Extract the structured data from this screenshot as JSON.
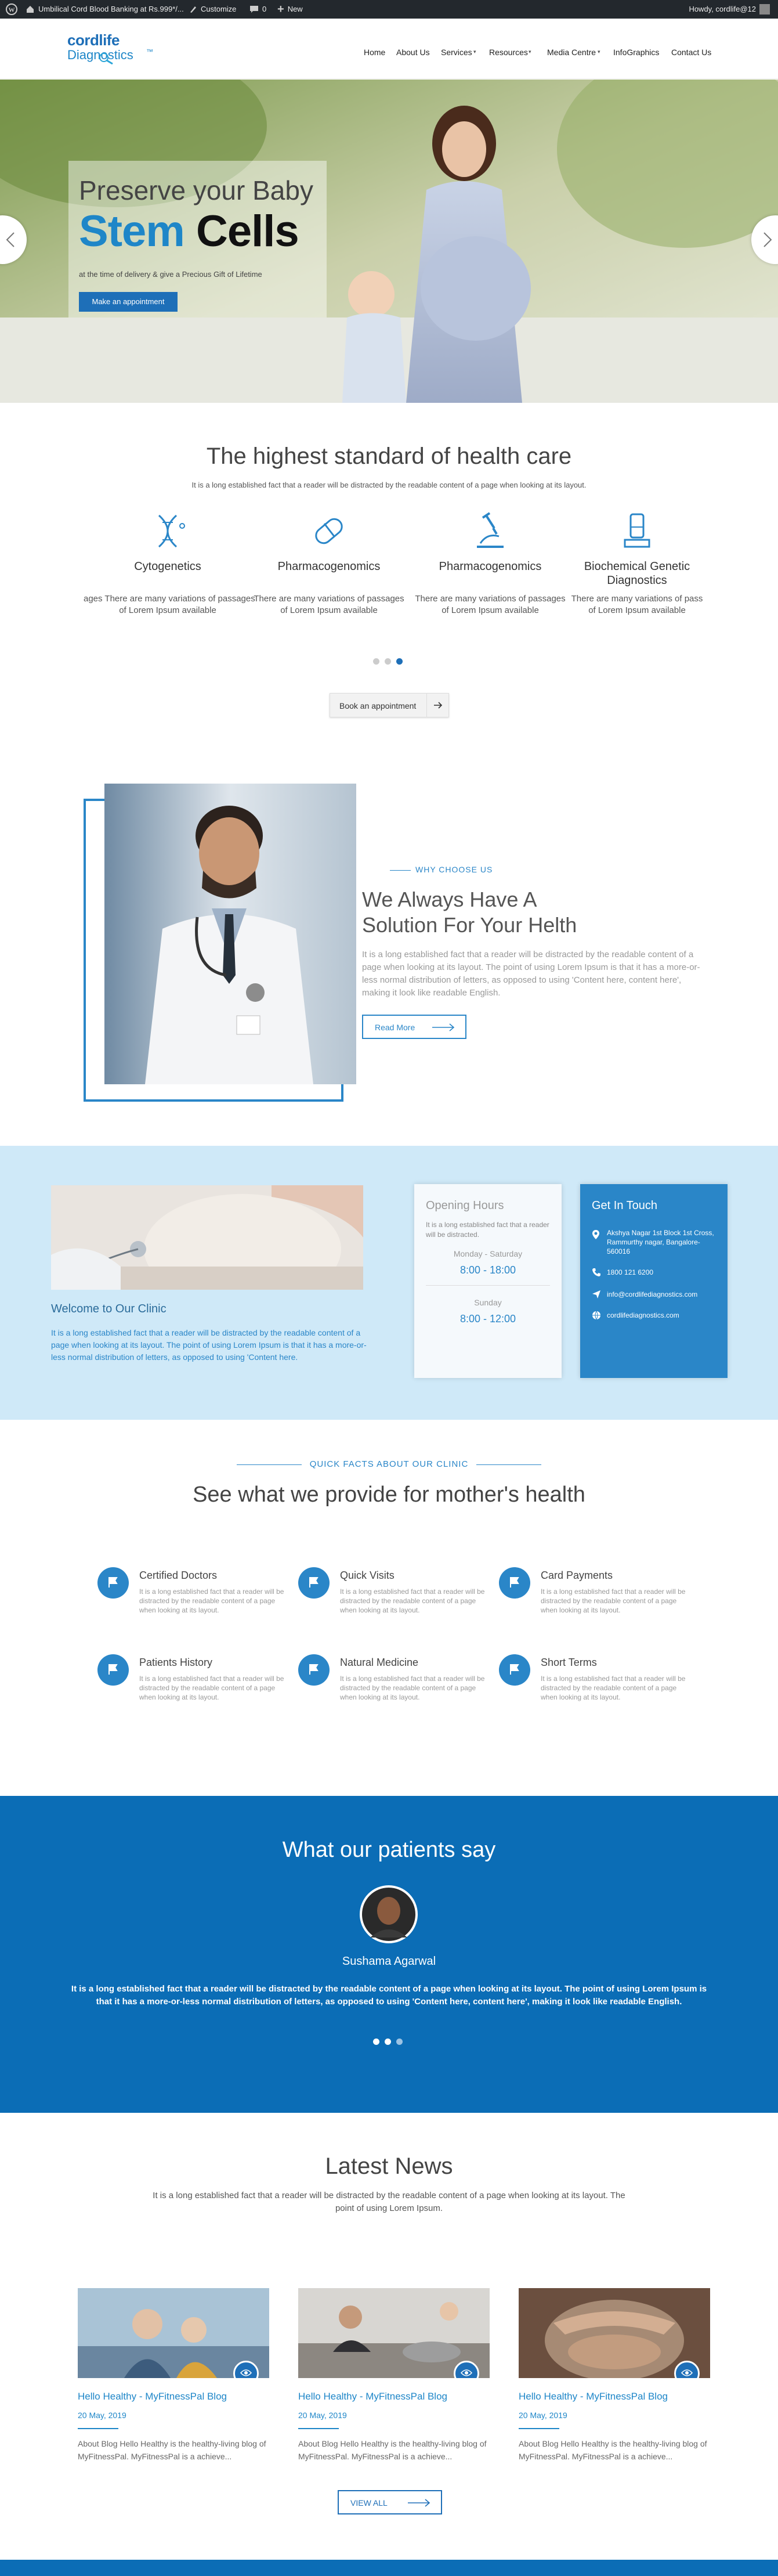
{
  "admin_bar": {
    "site_name": "Umbilical Cord Blood Banking at Rs.999*/...",
    "customize": "Customize",
    "comments": "0",
    "new": "New",
    "howdy": "Howdy, cordlife@12"
  },
  "brand": {
    "logo_top": "cordlife",
    "logo_bottom": "Diagnostics",
    "tm": "™",
    "primary_color": "#1e6fb8",
    "accent_color": "#2a86c8"
  },
  "nav": {
    "items": [
      "Home",
      "About Us",
      "Services",
      "Resources",
      "Media Centre",
      "InfoGraphics",
      "Contact Us"
    ],
    "dropdown_items": [
      "Services",
      "Resources",
      "Media Centre"
    ]
  },
  "hero": {
    "title_line1": "Preserve your Baby",
    "title_blue": "Stem",
    "title_black": "Cells",
    "subtitle": "at the time of delivery & give a Precious Gift of Lifetime",
    "cta": "Make an appointment"
  },
  "standard": {
    "title": "The highest standard of health care",
    "subtitle": "It is a long established fact that a reader will be distracted by the readable content of a page when looking at its layout.",
    "services": [
      {
        "name": "Cytogenetics",
        "icon": "dna-icon",
        "desc1": "ages There are many variations of passages",
        "desc2": "of Lorem Ipsum available"
      },
      {
        "name": "Pharmacogenomics",
        "icon": "pill-icon",
        "desc1": "There are many variations of passages",
        "desc2": "of Lorem Ipsum available"
      },
      {
        "name": "Pharmacogenomics",
        "icon": "microscope-icon",
        "desc1": "There are many variations of passages",
        "desc2": "of Lorem Ipsum available"
      },
      {
        "name": "Biochemical Genetic Diagnostics",
        "icon": "lab-icon",
        "desc1": "There are many variations of pass",
        "desc2": "of Lorem Ipsum available"
      }
    ],
    "book": "Book an appointment"
  },
  "why": {
    "kicker": "WHY CHOOSE US",
    "title_line1": "We Always Have A",
    "title_line2": "Solution For Your Helth",
    "text": "It is a long established fact that a reader will be distracted by the readable content of a page when looking at its layout. The point of using Lorem Ipsum is that it has a more-or-less normal distribution of letters, as opposed to using 'Content here, content here', making it look like readable English.",
    "read_more": "Read More"
  },
  "clinic": {
    "welcome_title": "Welcome to Our Clinic",
    "welcome_text": "It is a long established fact that a reader will be distracted by the readable content of a page when looking at its layout. The point of using Lorem Ipsum is that it has a more-or-less normal distribution of letters, as opposed to using 'Content here.",
    "hours_title": "Opening Hours",
    "hours_text": "It is a long established fact that a reader will be distracted.",
    "weekday_label": "Monday - Saturday",
    "weekday_time": "8:00 - 18:00",
    "sunday_label": "Sunday",
    "sunday_time": "8:00 - 12:00",
    "touch_title": "Get In Touch",
    "address": "Akshya Nagar 1st Block 1st Cross, Rammurthy nagar, Bangalore-560016",
    "phone": "1800 121 6200",
    "email": "info@cordlifediagnostics.com",
    "web": "cordlifediagnostics.com"
  },
  "facts": {
    "kicker": "QUICK FACTS ABOUT OUR CLINIC",
    "title": "See what we provide for mother's health",
    "items": [
      {
        "title": "Certified Doctors",
        "desc": "It is a long established fact that a reader will be distracted by the readable content of a page when looking at its layout."
      },
      {
        "title": "Quick Visits",
        "desc": "It is a long established fact that a reader will be distracted by the readable content of a page when looking at its layout."
      },
      {
        "title": "Card Payments",
        "desc": "It is a long established fact that a reader will be distracted by the readable content of a page when looking at its layout."
      },
      {
        "title": "Patients History",
        "desc": "It is a long established fact that a reader will be distracted by the readable content of a page when looking at its layout."
      },
      {
        "title": "Natural Medicine",
        "desc": "It is a long established fact that a reader will be distracted by the readable content of a page when looking at its layout."
      },
      {
        "title": "Short Terms",
        "desc": "It is a long established fact that a reader will be distracted by the readable content of a page when looking at its layout."
      }
    ]
  },
  "testimonials": {
    "title": "What our patients say",
    "name": "Sushama Agarwal",
    "quote_line1": "It is a long established fact that a reader will be distracted by the readable content of a page when looking at its layout. The point of using Lorem Ipsum is",
    "quote_line2": "that it has a more-or-less normal distribution of letters, as opposed to using 'Content here, content here', making it look like readable English."
  },
  "news": {
    "title": "Latest News",
    "subtitle_line1": "It is a long established fact that a reader will be distracted by the readable content of a page when looking at its layout. The",
    "subtitle_line2": "point of using Lorem Ipsum.",
    "items": [
      {
        "title": "Hello Healthy - MyFitnessPal Blog",
        "date": "20 May, 2019",
        "excerpt": "About Blog Hello Healthy is the healthy-living blog of MyFitnessPal. MyFitnessPal is a achieve..."
      },
      {
        "title": "Hello Healthy - MyFitnessPal Blog",
        "date": "20 May, 2019",
        "excerpt": "About Blog Hello Healthy is the healthy-living blog of MyFitnessPal. MyFitnessPal is a achieve..."
      },
      {
        "title": "Hello Healthy - MyFitnessPal Blog",
        "date": "20 May, 2019",
        "excerpt": "About Blog Hello Healthy is the healthy-living blog of MyFitnessPal. MyFitnessPal is a achieve..."
      }
    ],
    "view_all": "VIEW ALL"
  }
}
